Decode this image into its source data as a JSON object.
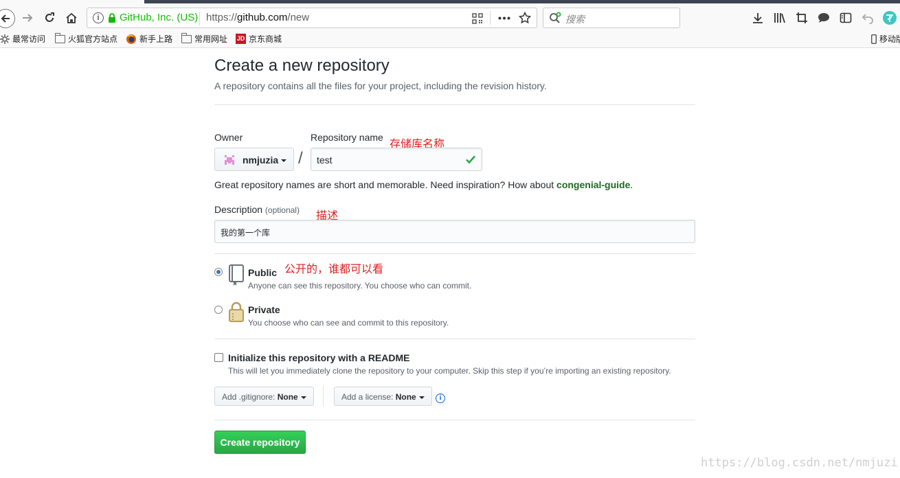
{
  "browser": {
    "identity": "GitHub, Inc. (US)",
    "url_prefix": "https://",
    "url_host": "github.com",
    "url_path": "/new",
    "search_placeholder": "搜索",
    "bookmarks": [
      {
        "label": "最常访问",
        "icon": "gear-icon"
      },
      {
        "label": "火狐官方站点",
        "icon": "folder-icon"
      },
      {
        "label": "新手上路",
        "icon": "firefox-icon"
      },
      {
        "label": "常用网址",
        "icon": "folder-icon"
      },
      {
        "label": "京东商城",
        "icon": "jd-icon"
      }
    ],
    "mobile_bookmark": "移动版"
  },
  "page": {
    "title": "Create a new repository",
    "subtitle": "A repository contains all the files for your project, including the revision history.",
    "owner_label": "Owner",
    "owner_value": "nmjuzia",
    "slash": "/",
    "repo_name_label": "Repository name",
    "repo_name_value": "test",
    "hint_prefix": "Great repository names are short and memorable. Need inspiration? How about ",
    "hint_suggestion": "congenial-guide",
    "hint_suffix": ".",
    "description_label": "Description",
    "description_optional": "(optional)",
    "description_value": "我的第一个库",
    "visibility": {
      "public_title": "Public",
      "public_desc": "Anyone can see this repository. You choose who can commit.",
      "private_title": "Private",
      "private_desc": "You choose who can see and commit to this repository.",
      "selected": "public"
    },
    "readme_title": "Initialize this repository with a README",
    "readme_desc": "This will let you immediately clone the repository to your computer. Skip this step if you’re importing an existing repository.",
    "gitignore_prefix": "Add .gitignore:",
    "gitignore_value": "None",
    "license_prefix": "Add a license:",
    "license_value": "None",
    "create_button": "Create repository"
  },
  "annotations": {
    "repo_name_note": "存储库名称",
    "description_note": "描述",
    "public_note": "公开的，谁都可以看"
  },
  "watermark": "https://blog.csdn.net/nmjuzi",
  "colors": {
    "primary_button": "#2cbe4e",
    "identity_green": "#12bc00",
    "annotation_red": "#e02020",
    "link_blue": "#0366d6"
  }
}
